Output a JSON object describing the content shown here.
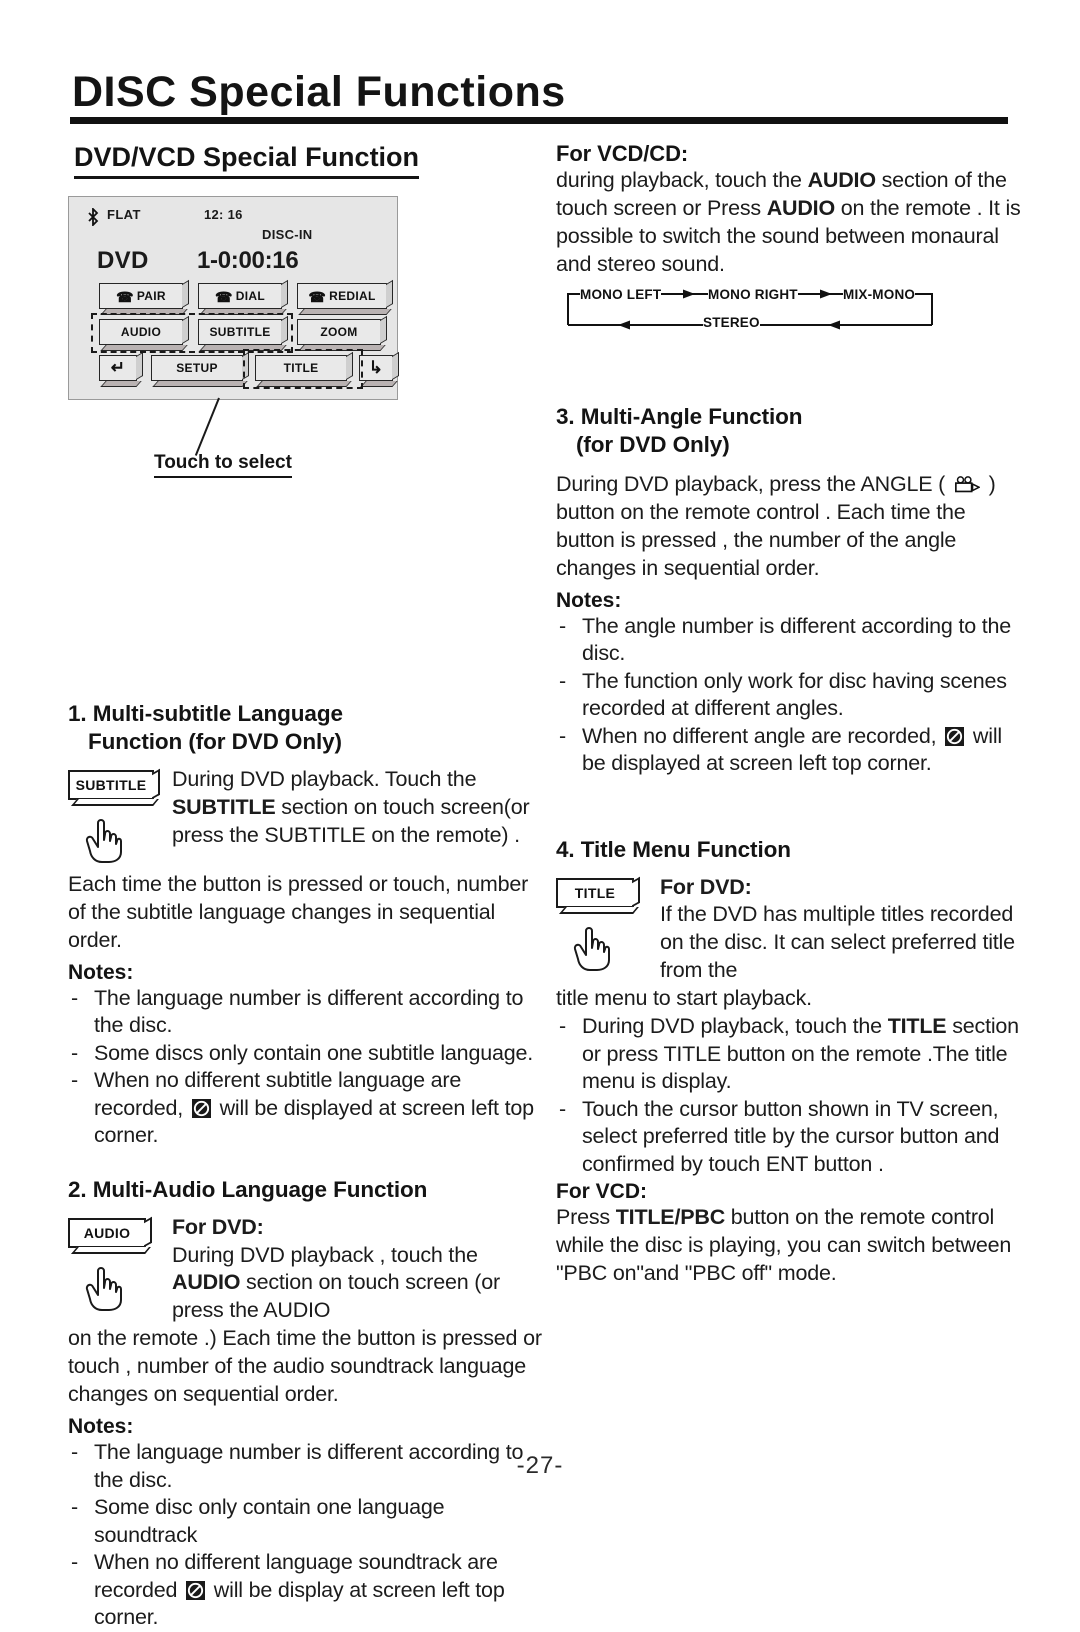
{
  "header": {
    "title": "DISC Special Functions",
    "section_title": "DVD/VCD Special Function"
  },
  "device": {
    "bt_icon": "bluetooth-icon",
    "eq_mode": "FLAT",
    "clock": "12: 16",
    "disc_status": "DISC-IN",
    "source": "DVD",
    "time": "1-0:00:16",
    "buttons": [
      {
        "label": "PAIR",
        "icon": "phone-pair-icon"
      },
      {
        "label": "DIAL",
        "icon": "phone-dial-icon"
      },
      {
        "label": "REDIAL",
        "icon": "phone-redial-icon"
      },
      {
        "label": "AUDIO",
        "icon": ""
      },
      {
        "label": "SUBTITLE",
        "icon": ""
      },
      {
        "label": "ZOOM",
        "icon": ""
      },
      {
        "label": "",
        "icon": "enter-left-arrow-icon"
      },
      {
        "label": "SETUP",
        "icon": ""
      },
      {
        "label": "TITLE",
        "icon": ""
      },
      {
        "label": "",
        "icon": "enter-right-arrow-icon"
      }
    ],
    "callout": "Touch to select"
  },
  "left_column": {
    "section1": {
      "heading_line1": "1. Multi-subtitle Language",
      "heading_line2": "Function (for DVD Only)",
      "key_label": "SUBTITLE",
      "body_lead": "During DVD playback. Touch the SUBTITLE section on touch screen(or press the SUBTITLE on the remote) .",
      "body_cont": "Each time the button is pressed or touch, number of the subtitle language changes in sequential order.",
      "notes_label": "Notes:",
      "notes": [
        "The language number is different according to the disc.",
        "Some discs only contain one subtitle language.",
        "When no different subtitle language are recorded,  will be displayed at screen left top corner."
      ],
      "note3_before": "When no different subtitle language are recorded, ",
      "note3_after": " will be displayed at screen left top corner."
    },
    "section2": {
      "heading": "2. Multi-Audio Language Function",
      "key_label": "AUDIO",
      "for_dvd": "For DVD:",
      "body_lead": "During DVD playback , touch the AUDIO section on touch screen (or press the AUDIO",
      "body_cont": "on the remote .) Each time the button is pressed or touch , number of the audio soundtrack language changes on sequential order.",
      "notes_label": "Notes:",
      "notes": [
        "The language number is different according to the disc.",
        "Some disc only contain one language soundtrack"
      ],
      "note3_before": "When no different language soundtrack are recorded ",
      "note3_after": " will be display at screen left top corner."
    }
  },
  "right_column": {
    "vcd_cd": {
      "heading": "For VCD/CD:",
      "body": "during playback, touch the  AUDIO section of the touch screen or Press AUDIO on the remote . It is possible to switch the sound between monaural and stereo sound."
    },
    "audio_cycle": {
      "mono_left": "MONO LEFT",
      "mono_right": "MONO RIGHT",
      "mix_mono": "MIX-MONO",
      "stereo": "STEREO"
    },
    "section3": {
      "heading_line1": "3. Multi-Angle Function",
      "heading_line2": "(for DVD Only)",
      "body_part1": "During DVD playback, press the ANGLE ( ",
      "angle_icon": "movie-camera-icon",
      "body_part2": " ) button on the remote control . Each time the button is pressed , the number of the angle changes in sequential order.",
      "notes_label": "Notes:",
      "notes": [
        "The angle number is different according to the disc.",
        "The function only work for disc having scenes recorded at different angles."
      ],
      "note3_before": "When no different angle are recorded, ",
      "note3_after": " will be displayed at screen left top corner."
    },
    "section4": {
      "heading": "4. Title Menu Function",
      "key_label": "TITLE",
      "for_dvd": "For DVD:",
      "body_lead": "If the DVD has multiple titles recorded on the disc. It can select preferred title from the",
      "body_cont": "title menu to start playback.",
      "bullets": [
        "During DVD playback, touch the TITLE section or press TITLE button on the remote .The title menu is display.",
        "Touch the cursor button shown in TV screen, select preferred title by the cursor button and confirmed by touch ENT button ."
      ],
      "for_vcd": "For VCD:",
      "vcd_body": "Press TITLE/PBC button on the remote control while the disc is playing, you can switch between \"PBC on\"and \"PBC off\" mode."
    }
  },
  "footer": {
    "page_number": "-27-"
  }
}
